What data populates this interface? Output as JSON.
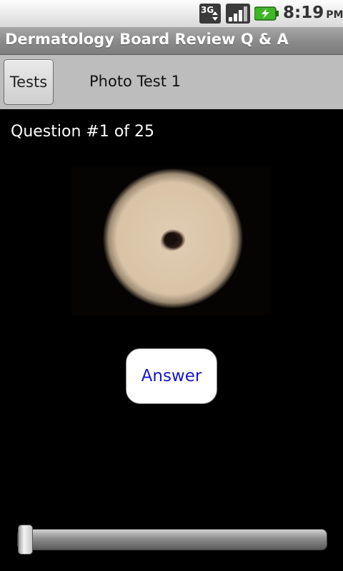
{
  "status_bar": {
    "network": "3G",
    "time": "8:19",
    "ampm": "PM",
    "icons": [
      "3g-data-icon",
      "signal-strength-icon",
      "battery-charging-icon"
    ],
    "battery_color": "#3fb528"
  },
  "titlebar": {
    "title": "Dermatology Board Review Q & A"
  },
  "toolbar": {
    "tests_label": "Tests",
    "test_name": "Photo Test 1"
  },
  "main": {
    "question_label": "Question #1 of 25",
    "answer_label": "Answer",
    "answer_color": "#1515c8"
  },
  "slider": {
    "current": 1,
    "total": 25
  }
}
